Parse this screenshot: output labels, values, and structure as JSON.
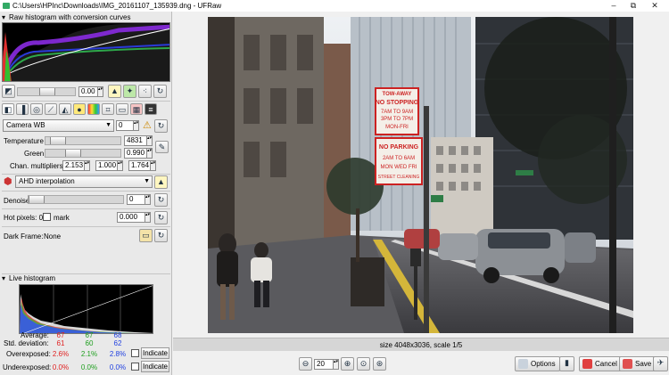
{
  "window": {
    "title": "C:\\Users\\HPInc\\Downloads\\IMG_20161107_135939.dng - UFRaw",
    "minimize": "–",
    "maximize": "⧉",
    "close": "✕"
  },
  "raw_histogram": {
    "header": "Raw histogram with conversion curves"
  },
  "exposure": {
    "value": "0.00"
  },
  "white_balance": {
    "preset": "Camera WB",
    "fine_tune": "0",
    "temperature_label": "Temperature",
    "temperature_value": "4831",
    "green_label": "Green",
    "green_value": "0.990",
    "multipliers_label": "Chan. multipliers:",
    "multipliers": [
      "2.153",
      "1.000",
      "1.764"
    ]
  },
  "interpolation": {
    "value": "AHD interpolation"
  },
  "denoise": {
    "label": "Denoise",
    "value": "0"
  },
  "hot_pixels": {
    "label": "Hot pixels: 0",
    "mark_label": "mark",
    "value": "0.000"
  },
  "dark_frame": {
    "label": "Dark Frame:",
    "value": "None"
  },
  "live_histogram": {
    "header": "Live histogram",
    "average_label": "Average:",
    "average": [
      "67",
      "67",
      "68"
    ],
    "stddev_label": "Std. deviation:",
    "stddev": [
      "61",
      "60",
      "62"
    ],
    "overexposed_label": "Overexposed:",
    "overexposed": [
      "2.6%",
      "2.1%",
      "2.8%"
    ],
    "underexposed_label": "Underexposed:",
    "underexposed": [
      "0.0%",
      "0.0%",
      "0.0%"
    ],
    "indicate_label": "Indicate"
  },
  "colors": {
    "red": "#e02020",
    "green": "#20a020",
    "blue": "#2040e0"
  },
  "photo_signs": {
    "tow_away": "TOW-AWAY",
    "no_stopping": "NO STOPPING",
    "stop_hours": "7AM TO 9AM",
    "stop_hours2": "3PM TO 7PM",
    "stop_days": "MON-FRI",
    "no_parking": "NO PARKING",
    "park_hours": "2AM TO 6AM",
    "park_days": "MON WED FRI",
    "park_note": "STREET CLEANING"
  },
  "status": {
    "text": "size 4048x3036, scale 1/5"
  },
  "zoom": {
    "value": "20"
  },
  "buttons": {
    "options": "Options",
    "cancel": "Cancel",
    "save": "Save"
  }
}
